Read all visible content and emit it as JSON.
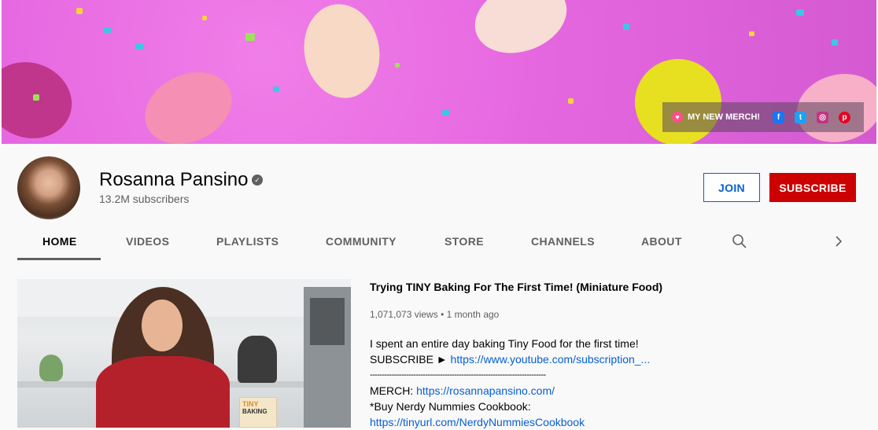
{
  "banner": {
    "merch_label": "MY NEW MERCH!",
    "social_icons": [
      "facebook-icon",
      "twitter-icon",
      "instagram-icon",
      "pinterest-icon"
    ]
  },
  "channel": {
    "name": "Rosanna Pansino",
    "subscribers": "13.2M subscribers",
    "join_label": "JOIN",
    "subscribe_label": "SUBSCRIBE"
  },
  "tabs": [
    {
      "label": "HOME"
    },
    {
      "label": "VIDEOS"
    },
    {
      "label": "PLAYLISTS"
    },
    {
      "label": "COMMUNITY"
    },
    {
      "label": "STORE"
    },
    {
      "label": "CHANNELS"
    },
    {
      "label": "ABOUT"
    }
  ],
  "featured": {
    "title": "Trying TINY Baking For The First Time! (Miniature Food)",
    "views": "1,071,073 views",
    "age": "1 month ago",
    "thumb_book_text": "TINY",
    "thumb_book_text2": "BAKING",
    "desc_line1": "I spent an entire day baking Tiny Food for the first time!",
    "desc_sub_label": "SUBSCRIBE ►",
    "desc_sub_link": "https://www.youtube.com/subscription_...",
    "desc_divider": "-------------------------------------------------------------------------",
    "desc_merch_label": "MERCH:",
    "desc_merch_link": "https://rosannapansino.com/",
    "desc_book_label": "*Buy Nerdy Nummies Cookbook:",
    "desc_book_link": "https://tinyurl.com/NerdyNummiesCookbook"
  },
  "colors": {
    "subscribe": "#cc0000",
    "join_border": "#065fd4",
    "banner_bg": "#e567e0"
  }
}
